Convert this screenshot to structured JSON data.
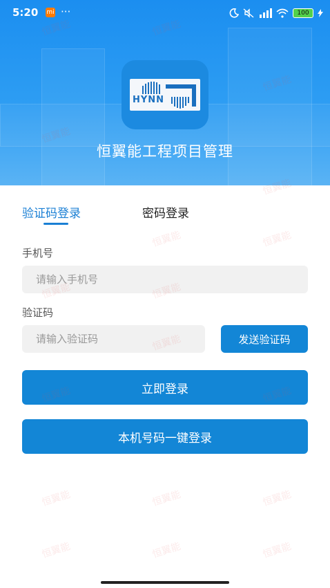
{
  "status_bar": {
    "time": "5:20",
    "mi_badge": "mi",
    "more": "···",
    "battery": "100"
  },
  "app": {
    "title": "恒翼能工程项目管理",
    "logo_text": "HYNN"
  },
  "tabs": [
    {
      "label": "验证码登录",
      "active": true
    },
    {
      "label": "密码登录",
      "active": false
    }
  ],
  "form": {
    "phone_label": "手机号",
    "phone_placeholder": "请输入手机号",
    "code_label": "验证码",
    "code_placeholder": "请输入验证码",
    "send_code_label": "发送验证码"
  },
  "buttons": {
    "login": "立即登录",
    "one_click_login": "本机号码一键登录"
  },
  "watermark_text": "恒翼能",
  "colors": {
    "primary": "#1386d6",
    "header_top": "#1b8ef0",
    "accent_text": "#1a7fd4"
  }
}
